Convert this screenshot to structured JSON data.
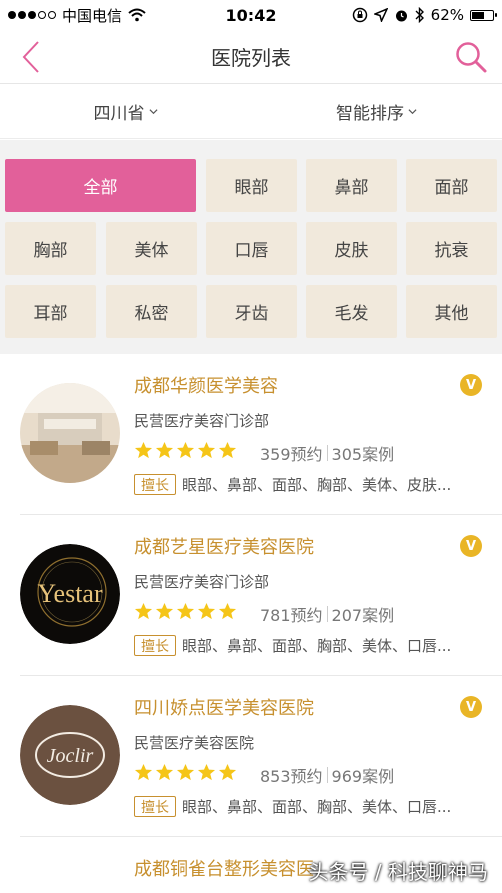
{
  "status_bar": {
    "carrier": "中国电信",
    "time": "10:42",
    "battery": "62%",
    "battery_level": 0.62
  },
  "nav": {
    "title": "医院列表",
    "back_icon": "chevron-left-icon",
    "search_icon": "search-icon"
  },
  "filters": [
    {
      "label": "四川省"
    },
    {
      "label": "智能排序"
    }
  ],
  "categories": [
    "全部",
    "眼部",
    "鼻部",
    "面部",
    "胸部",
    "美体",
    "口唇",
    "皮肤",
    "抗衰",
    "耳部",
    "私密",
    "牙齿",
    "毛发",
    "其他"
  ],
  "colors": {
    "accent": "#e2609a",
    "gold": "#c7902f",
    "badge": "#e9b526",
    "category_bg": "#f1e9dc"
  },
  "hospitals": [
    {
      "name": "成都华颜医学美容",
      "type": "民营医疗美容门诊部",
      "rating": 5,
      "appointments": "359预约",
      "cases": "305案例",
      "tag": "擅长",
      "specialties": "眼部、鼻部、面部、胸部、美体、皮肤...",
      "badge": "V"
    },
    {
      "name": "成都艺星医疗美容医院",
      "type": "民营医疗美容门诊部",
      "rating": 5,
      "appointments": "781预约",
      "cases": "207案例",
      "tag": "擅长",
      "specialties": "眼部、鼻部、面部、胸部、美体、口唇...",
      "badge": "V",
      "logo_text": "Yestar"
    },
    {
      "name": "四川娇点医学美容医院",
      "type": "民营医疗美容医院",
      "rating": 5,
      "appointments": "853预约",
      "cases": "969案例",
      "tag": "擅长",
      "specialties": "眼部、鼻部、面部、胸部、美体、口唇...",
      "badge": "V",
      "logo_text": "Joclir"
    },
    {
      "name": "成都铜雀台整形美容医"
    }
  ],
  "watermark": "头条号 / 科技聊神马"
}
